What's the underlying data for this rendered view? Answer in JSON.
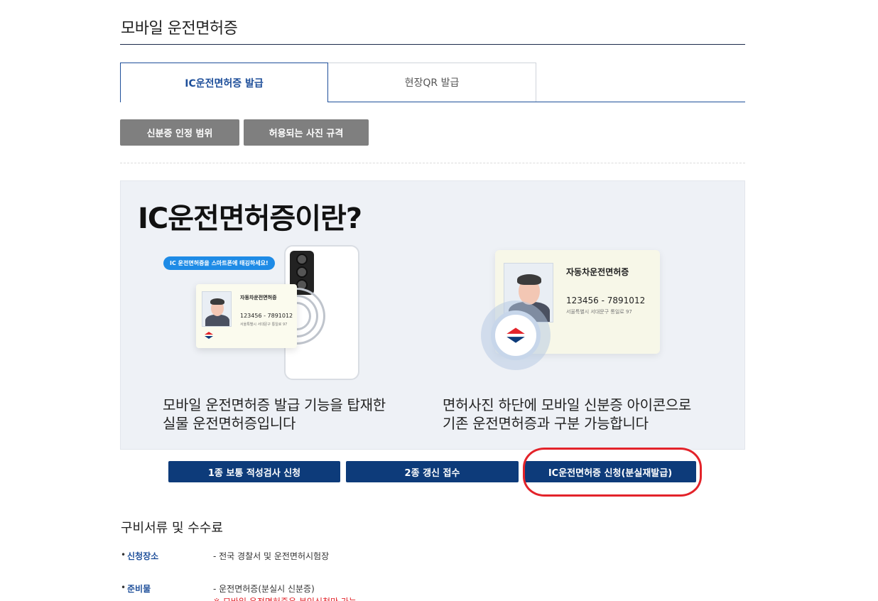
{
  "page": {
    "title": "모바일 운전면허증"
  },
  "tabs": [
    {
      "label": "IC운전면허증 발급",
      "active": true
    },
    {
      "label": "현장QR 발급",
      "active": false
    }
  ],
  "gray_buttons": [
    "신분증 인정 범위",
    "허용되는 사진 규격"
  ],
  "info": {
    "heading": "IC운전면허증이란?",
    "caption_left": [
      "모바일 운전면허증 발급 기능을 탑재한",
      "실물 운전면허증입니다"
    ],
    "caption_right": [
      "면허사진 하단에 모바일 신분증 아이콘으로",
      "기존 운전면허증과 구분 가능합니다"
    ],
    "bubble_text": "IC 운전면허증을 스마트폰에 태깅하세요!",
    "card": {
      "title": "자동차운전면허증",
      "number": "123456 - 7891012",
      "address": "서울특별시 서대문구 통일로 97"
    }
  },
  "action_buttons": [
    "1종 보통 적성검사 신청",
    "2종 갱신 접수",
    "IC운전면허증 신청(분실재발급)"
  ],
  "documents": {
    "title": "구비서류 및 수수료",
    "rows": [
      {
        "label": "신청장소",
        "value": "- 전국 경찰서 및 운전면허시험장"
      },
      {
        "label": "준비물",
        "value": "- 운전면허증(분실시 신분증)"
      }
    ],
    "note": "※ 모바일 운전면허증은 본인신청만 가능"
  },
  "colors": {
    "brand_blue": "#0d3b7a",
    "tab_blue": "#1e4f9a",
    "gray_button": "#7f7f7f",
    "highlight_red": "#e3232a"
  }
}
